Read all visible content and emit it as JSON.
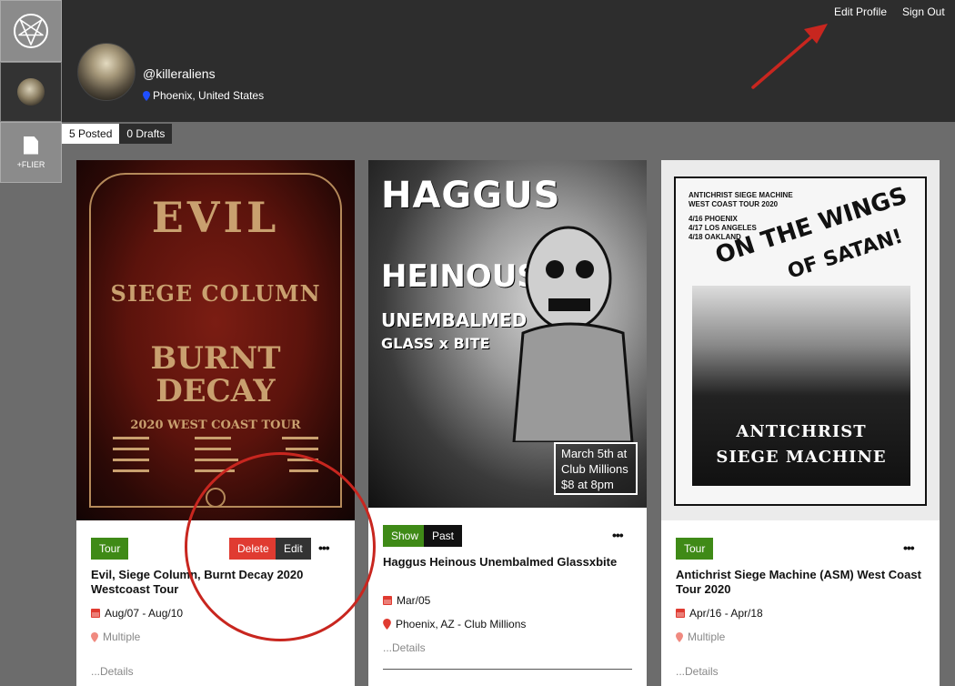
{
  "rail": {
    "add_flier_label": "+FLIER"
  },
  "header": {
    "edit_profile": "Edit Profile",
    "sign_out": "Sign Out",
    "username": "@killeraliens",
    "location": "Phoenix, United States"
  },
  "tabs": [
    {
      "label": "5 Posted"
    },
    {
      "label": "0 Drafts"
    }
  ],
  "cards": [
    {
      "poster": {
        "band1": "EVIL",
        "band2": "SIEGE COLUMN",
        "band3": "BURNT DECAY",
        "tour": "2020 WEST COAST TOUR"
      },
      "badge": "Tour",
      "delete_label": "Delete",
      "edit_label": "Edit",
      "more": "•••",
      "title": "Evil, Siege Column, Burnt Decay 2020 Westcoast Tour",
      "date": "Aug/07 - Aug/10",
      "location": "Multiple",
      "details": "...Details"
    },
    {
      "poster": {
        "band1": "HAGGUS",
        "band2": "HEINOUS",
        "band3": "UNEMBALMED",
        "band4": "GLASS x BITE",
        "info_line1": "March 5th at",
        "info_line2": "Club Millions",
        "info_line3": "$8 at 8pm"
      },
      "badge_show": "Show",
      "badge_past": "Past",
      "more": "•••",
      "title": "Haggus Heinous Unembalmed Glassxbite",
      "date": "Mar/05",
      "location": "Phoenix, AZ - Club Millions",
      "details": "...Details"
    },
    {
      "poster": {
        "header1": "ANTICHRIST SIEGE MACHINE",
        "header2": "WEST COAST TOUR 2020",
        "date1": "4/16 PHOENIX",
        "date2": "4/17 LOS ANGELES",
        "date3": "4/18 OAKLAND",
        "slogan1": "ON THE WINGS",
        "slogan2": "OF SATAN!",
        "band_logo1": "ANTICHRIST",
        "band_logo2": "SIEGE MACHINE"
      },
      "badge": "Tour",
      "more": "•••",
      "title": "Antichrist Siege Machine (ASM) West Coast Tour 2020",
      "date": "Apr/16 - Apr/18",
      "location": "Multiple",
      "details": "...Details"
    }
  ],
  "colors": {
    "header_bg": "#2d2d2d",
    "page_bg": "#6c6c6c",
    "badge_green": "#3f8a17",
    "delete_red": "#e03b31",
    "annotation_red": "#c8261f",
    "pin_blue": "#1f4fff"
  }
}
